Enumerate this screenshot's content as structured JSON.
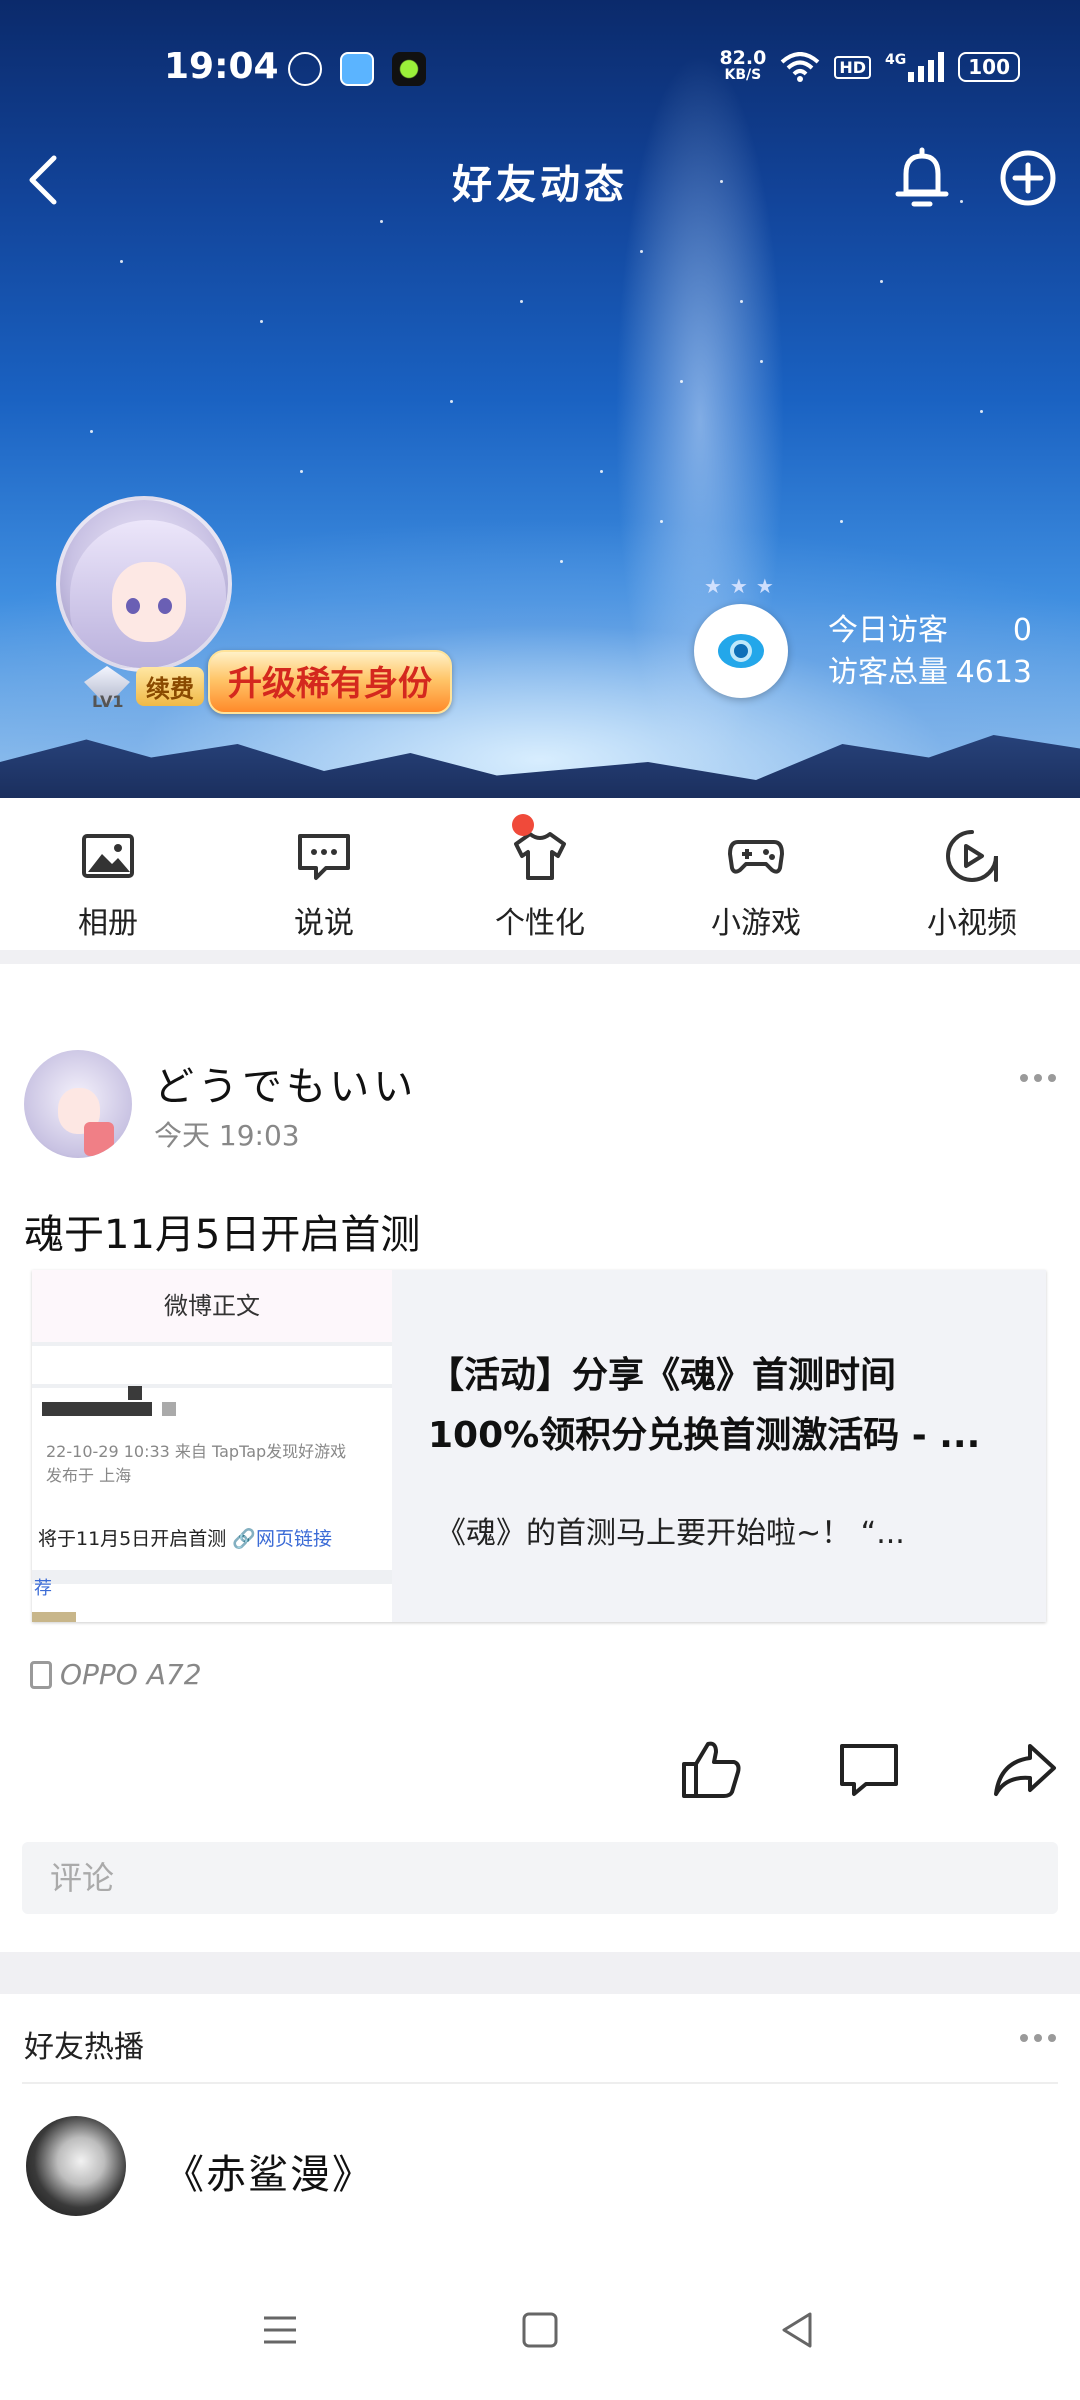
{
  "status_bar": {
    "time": "19:04",
    "network_speed_value": "82.0",
    "network_speed_unit": "KB/S",
    "hd_label": "HD",
    "signal_label": "4G",
    "battery": "100"
  },
  "header": {
    "title": "好友动态",
    "back_icon": "back-icon",
    "bell_icon": "bell-icon",
    "add_icon": "plus-circle-icon"
  },
  "profile": {
    "level_label": "LV1",
    "renew_label": "续费",
    "upgrade_label": "升级稀有身份",
    "visitors_today_label": "今日访客",
    "visitors_today_value": "0",
    "visitors_total_label": "访客总量",
    "visitors_total_value": "4613"
  },
  "quick_nav": [
    {
      "label": "相册",
      "icon": "photo-icon"
    },
    {
      "label": "说说",
      "icon": "chat-bubble-icon"
    },
    {
      "label": "个性化",
      "icon": "tshirt-icon",
      "has_badge": true
    },
    {
      "label": "小游戏",
      "icon": "gamepad-icon"
    },
    {
      "label": "小视频",
      "icon": "play-circle-icon"
    }
  ],
  "post": {
    "username": "どうでもいい",
    "time": "今天 19:03",
    "text": "魂于11月5日开启首测",
    "card": {
      "thumb_header": "微博正文",
      "thumb_meta_line1": "22-10-29 10:33  来自 TapTap发现好游戏",
      "thumb_meta_line2": "发布于 上海",
      "thumb_body": "将于11月5日开启首测",
      "thumb_link": "网页链接",
      "thumb_recommend": "荐",
      "title_line1": "【活动】分享《魂》首测时间",
      "title_line2": "100%领积分兑换首测激活码 - ...",
      "desc": "《魂》的首测马上要开始啦~！ “..."
    },
    "device": "OPPO A72",
    "comment_placeholder": "评论"
  },
  "hot": {
    "title": "好友热播",
    "item_name": "《赤鲨漫》"
  },
  "colors": {
    "accent_blue": "#23a7ea",
    "badge_red": "#f04a3a",
    "upgrade_text": "#d4281e"
  }
}
